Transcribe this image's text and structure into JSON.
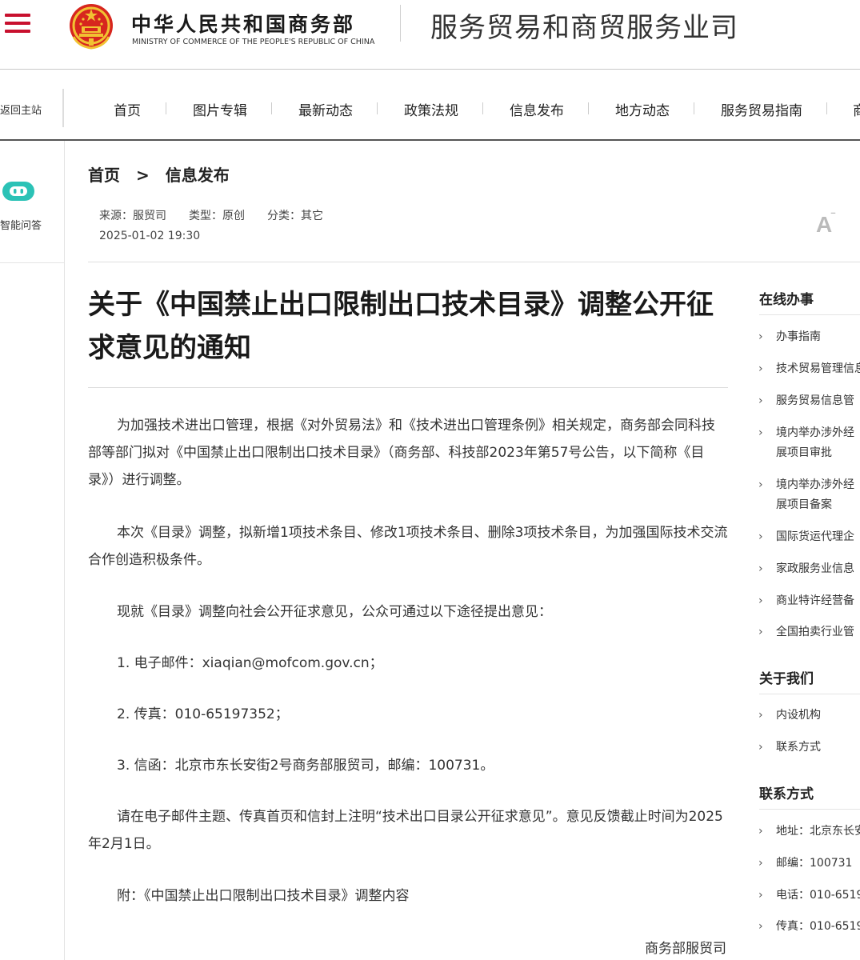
{
  "header": {
    "ministry_cn": "中华人民共和国商务部",
    "ministry_en": "MINISTRY OF COMMERCE OF THE PEOPLE'S REPUBLIC OF CHINA",
    "dept_name": "服务贸易和商贸服务业司",
    "accent_color": "#c8102e"
  },
  "nav": {
    "return_label": "返回主站",
    "items": [
      "首页",
      "图片专辑",
      "最新动态",
      "政策法规",
      "信息发布",
      "地方动态",
      "服务贸易指南",
      "商"
    ]
  },
  "left_sidebar": {
    "ai_label": "智能问答",
    "ai_icon": "chat-robot-icon",
    "ai_icon_color": "#2bc2b6"
  },
  "breadcrumb": {
    "home": "首页",
    "separator": ">",
    "current": "信息发布"
  },
  "meta": {
    "source": "来源：服贸司",
    "type": "类型：原创",
    "category": "分类：其它",
    "date": "2025-01-02 19:30",
    "font_size_icon": "font-size-icon"
  },
  "article": {
    "title": "关于《中国禁止出口限制出口技术目录》调整公开征求意见的通知",
    "paragraphs": [
      "为加强技术进出口管理，根据《对外贸易法》和《技术进出口管理条例》相关规定，商务部会同科技部等部门拟对《中国禁止出口限制出口技术目录》（商务部、科技部2023年第57号公告，以下简称《目录》）进行调整。",
      "本次《目录》调整，拟新增1项技术条目、修改1项技术条目、删除3项技术条目，为加强国际技术交流合作创造积极条件。",
      "现就《目录》调整向社会公开征求意见，公众可通过以下途径提出意见：",
      "1. 电子邮件：xiaqian@mofcom.gov.cn；",
      "2. 传真：010-65197352；",
      "3. 信函：北京市东长安街2号商务部服贸司，邮编：100731。",
      "请在电子邮件主题、传真首页和信封上注明“技术出口目录公开征求意见”。意见反馈截止时间为2025年2月1日。",
      "附：《中国禁止出口限制出口技术目录》调整内容"
    ],
    "signature": "商务部服贸司"
  },
  "right_sidebar": {
    "online_title": "在线办事",
    "online_items": [
      {
        "line1": "办事指南",
        "line2": ""
      },
      {
        "line1": "技术贸易管理信息",
        "line2": ""
      },
      {
        "line1": "服务贸易信息管",
        "line2": ""
      },
      {
        "line1": "境内举办涉外经",
        "line2": "展项目审批"
      },
      {
        "line1": "境内举办涉外经",
        "line2": "展项目备案"
      },
      {
        "line1": "国际货运代理企",
        "line2": ""
      },
      {
        "line1": "家政服务业信息",
        "line2": ""
      },
      {
        "line1": "商业特许经营备",
        "line2": ""
      },
      {
        "line1": "全国拍卖行业管",
        "line2": ""
      }
    ],
    "about_title": "关于我们",
    "about_items": [
      "内设机构",
      "联系方式"
    ],
    "contact_title": "联系方式",
    "contact_items": [
      "地址：北京东长安",
      "邮编：100731",
      "电话：010-6519",
      "传真：010-6519"
    ]
  }
}
